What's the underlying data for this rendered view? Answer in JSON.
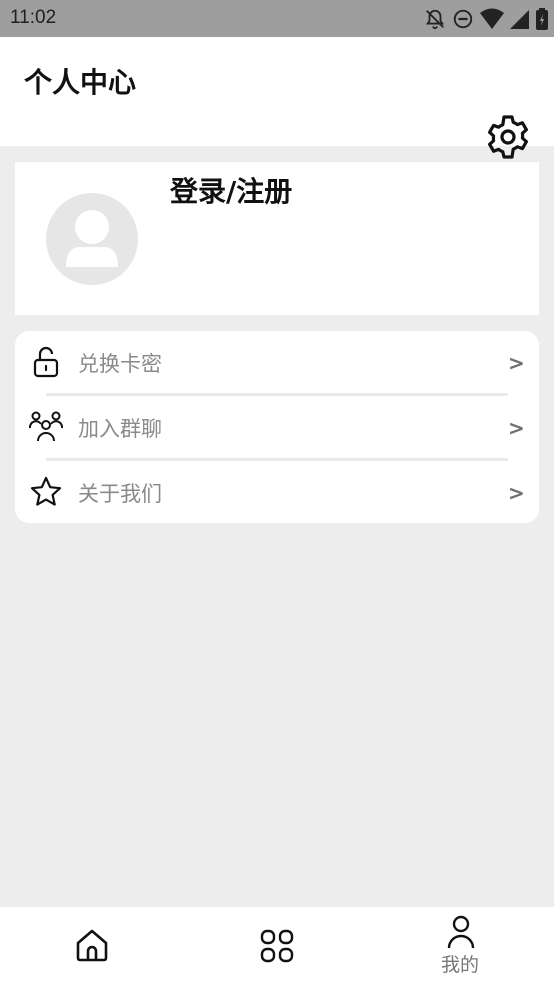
{
  "status": {
    "time": "11:02",
    "icons": [
      "bell-off-icon",
      "do-not-disturb-icon",
      "wifi-icon",
      "signal-icon",
      "battery-icon"
    ]
  },
  "header": {
    "title": "个人中心",
    "settings_icon": "gear-icon"
  },
  "profile": {
    "login_label": "登录/注册",
    "avatar_icon": "user-placeholder-icon"
  },
  "menu": {
    "items": [
      {
        "label": "兑换卡密",
        "icon": "unlock-icon",
        "chevron": ">"
      },
      {
        "label": "加入群聊",
        "icon": "group-icon",
        "chevron": ">"
      },
      {
        "label": "关于我们",
        "icon": "star-icon",
        "chevron": ">"
      }
    ]
  },
  "tabbar": {
    "tabs": [
      {
        "label": "",
        "icon": "home-icon",
        "active": false
      },
      {
        "label": "",
        "icon": "grid-icon",
        "active": false
      },
      {
        "label": "我的",
        "icon": "person-icon",
        "active": true
      }
    ]
  }
}
